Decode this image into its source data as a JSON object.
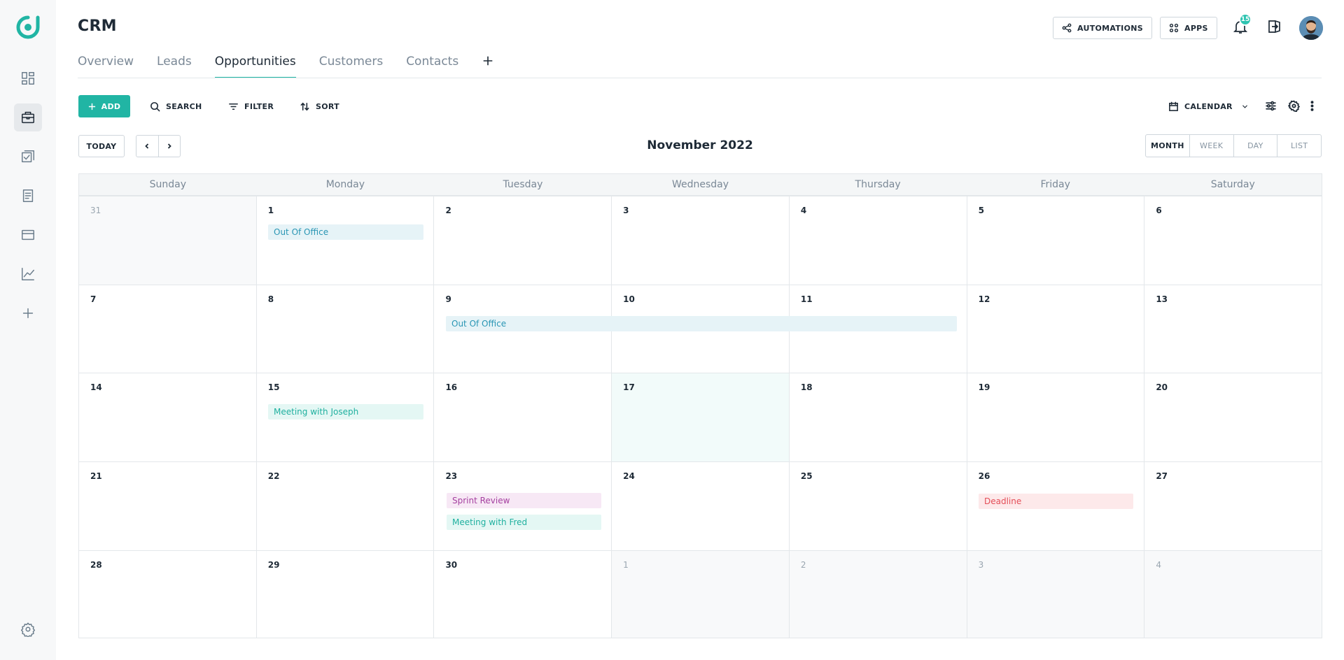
{
  "app": {
    "title": "CRM",
    "accent": "#21b5a4"
  },
  "sidebar": {
    "items": [
      {
        "icon": "dashboard-icon"
      },
      {
        "icon": "briefcase-icon",
        "active": true
      },
      {
        "icon": "tasks-icon"
      },
      {
        "icon": "document-icon"
      },
      {
        "icon": "card-icon"
      },
      {
        "icon": "chart-icon"
      },
      {
        "icon": "plus-icon"
      }
    ],
    "settings_icon": "gear-icon"
  },
  "header": {
    "automations_label": "AUTOMATIONS",
    "apps_label": "APPS",
    "notification_count": "15"
  },
  "tabs": [
    {
      "label": "Overview"
    },
    {
      "label": "Leads"
    },
    {
      "label": "Opportunities",
      "active": true
    },
    {
      "label": "Customers"
    },
    {
      "label": "Contacts"
    }
  ],
  "toolbar": {
    "add_label": "ADD",
    "search_label": "SEARCH",
    "filter_label": "FILTER",
    "sort_label": "SORT",
    "view_label": "CALENDAR"
  },
  "calendar": {
    "today_label": "TODAY",
    "title": "November 2022",
    "views": [
      "MONTH",
      "WEEK",
      "DAY",
      "LIST"
    ],
    "active_view": "MONTH",
    "weekdays": [
      "Sunday",
      "Monday",
      "Tuesday",
      "Wednesday",
      "Thursday",
      "Friday",
      "Saturday"
    ],
    "weeks": [
      [
        "31",
        "1",
        "2",
        "3",
        "4",
        "5",
        "6"
      ],
      [
        "7",
        "8",
        "9",
        "10",
        "11",
        "12",
        "13"
      ],
      [
        "14",
        "15",
        "16",
        "17",
        "18",
        "19",
        "20"
      ],
      [
        "21",
        "22",
        "23",
        "24",
        "25",
        "26",
        "27"
      ],
      [
        "28",
        "29",
        "30",
        "1",
        "2",
        "3",
        "4"
      ]
    ],
    "events": {
      "out_of_office_1": "Out Of Office",
      "out_of_office_2": "Out Of Office",
      "meeting_joseph": "Meeting with Joseph",
      "sprint_review": "Sprint Review",
      "meeting_fred": "Meeting with Fred",
      "deadline": "Deadline"
    }
  }
}
